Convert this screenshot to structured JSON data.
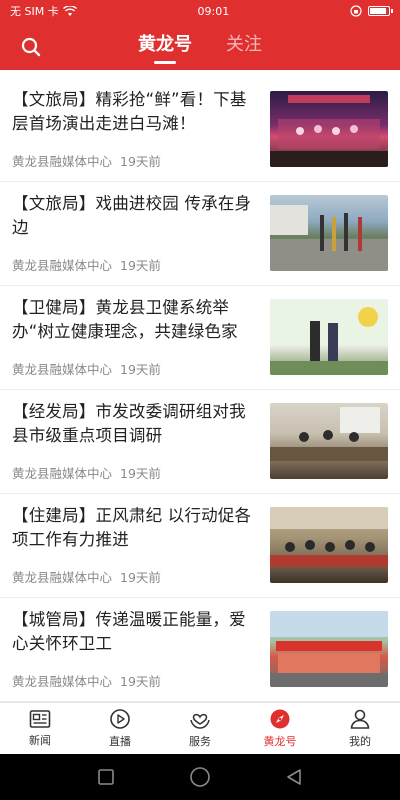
{
  "status_bar": {
    "carrier": "无 SIM 卡",
    "time": "09:01",
    "battery_level": 0.9
  },
  "header": {
    "tabs": [
      {
        "label": "黄龙号",
        "active": true
      },
      {
        "label": "关注",
        "active": false
      }
    ],
    "accent_color": "#e02f2f"
  },
  "feed": {
    "items": [
      {
        "title": "【文旅局】精彩抢“鲜”看！下基层首场演出走进白马滩！",
        "source": "黄龙县融媒体中心",
        "time": "19天前",
        "thumb": "stage-performance-photo"
      },
      {
        "title": "【文旅局】戏曲进校园 传承在身边",
        "source": "黄龙县融媒体中心",
        "time": "19天前",
        "thumb": "school-opera-photo"
      },
      {
        "title": "【卫健局】黄龙县卫健系统举办“树立健康理念，共建绿色家园”文…",
        "source": "黄龙县融媒体中心",
        "time": "19天前",
        "thumb": "health-event-photo"
      },
      {
        "title": "【经发局】市发改委调研组对我县市级重点项目调研",
        "source": "黄龙县融媒体中心",
        "time": "19天前",
        "thumb": "office-meeting-photo"
      },
      {
        "title": "【住建局】正风肃纪 以行动促各项工作有力推进",
        "source": "黄龙县融媒体中心",
        "time": "19天前",
        "thumb": "conference-room-photo"
      },
      {
        "title": "【城管局】传递温暖正能量，爱心关怀环卫工",
        "source": "黄龙县融媒体中心",
        "time": "19天前",
        "thumb": "group-banner-photo"
      }
    ]
  },
  "tabbar": {
    "items": [
      {
        "label": "新闻",
        "icon": "newspaper-icon",
        "active": false
      },
      {
        "label": "直播",
        "icon": "play-circle-icon",
        "active": false
      },
      {
        "label": "服务",
        "icon": "heart-hands-icon",
        "active": false
      },
      {
        "label": "黄龙号",
        "icon": "compass-icon",
        "active": true
      },
      {
        "label": "我的",
        "icon": "person-icon",
        "active": false
      }
    ]
  }
}
